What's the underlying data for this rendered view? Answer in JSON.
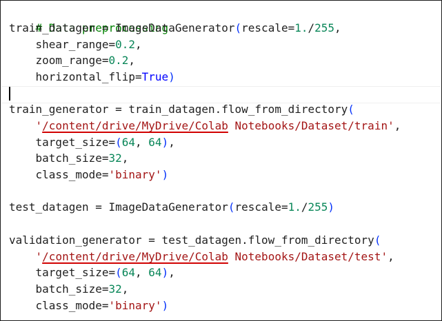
{
  "code": {
    "line1": {
      "comment": "# Data preprocessing"
    },
    "line2": {
      "lhs": "train_datagen = ImageDataGenerator",
      "open": "(",
      "arg": "rescale=",
      "num": "1.",
      "div": "/",
      "num2": "255",
      "comma": ","
    },
    "line3": {
      "arg": "    shear_range=",
      "num": "0.2",
      "comma": ","
    },
    "line4": {
      "arg": "    zoom_range=",
      "num": "0.2",
      "comma": ","
    },
    "line5": {
      "arg": "    horizontal_flip=",
      "bool": "True",
      "close": ")"
    },
    "line7": {
      "lhs": "train_generator = train_datagen.flow_from_directory",
      "open": "("
    },
    "line8": {
      "indent": "    ",
      "quote_open": "'",
      "path_underlined": "/content/drive/MyDrive/Colab",
      "path_rest": " Notebooks/Dataset/train",
      "quote_close": "'",
      "comma": ","
    },
    "line9": {
      "arg": "    target_size=",
      "open": "(",
      "num1": "64",
      "sep": ", ",
      "num2": "64",
      "close": ")",
      "comma": ","
    },
    "line10": {
      "arg": "    batch_size=",
      "num": "32",
      "comma": ","
    },
    "line11": {
      "arg": "    class_mode=",
      "str": "'binary'",
      "close": ")"
    },
    "line13": {
      "lhs": "test_datagen = ImageDataGenerator",
      "open": "(",
      "arg": "rescale=",
      "num": "1.",
      "div": "/",
      "num2": "255",
      "close": ")"
    },
    "line15": {
      "lhs": "validation_generator = test_datagen.flow_from_directory",
      "open": "("
    },
    "line16": {
      "indent": "    ",
      "quote_open": "'",
      "path_underlined": "/content/drive/MyDrive/Colab",
      "path_rest": " Notebooks/Dataset/test",
      "quote_close": "'",
      "comma": ","
    },
    "line17": {
      "arg": "    target_size=",
      "open": "(",
      "num1": "64",
      "sep": ", ",
      "num2": "64",
      "close": ")",
      "comma": ","
    },
    "line18": {
      "arg": "    batch_size=",
      "num": "32",
      "comma": ","
    },
    "line19": {
      "arg": "    class_mode=",
      "str": "'binary'",
      "close": ")"
    }
  },
  "colors": {
    "comment": "#008000",
    "number": "#098658",
    "keyword_bool": "#0000ff",
    "string": "#a31515",
    "bracket": "#0431fa",
    "text": "#1f1f1f",
    "spell_underline": "#d10000"
  }
}
